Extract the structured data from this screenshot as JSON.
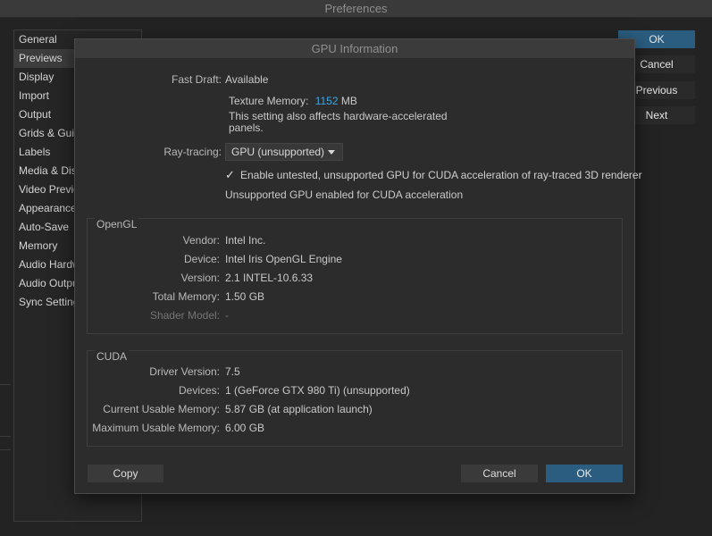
{
  "prefs": {
    "title": "Preferences",
    "sidebar": [
      {
        "label": "General",
        "selected": false
      },
      {
        "label": "Previews",
        "selected": true
      },
      {
        "label": "Display",
        "selected": false
      },
      {
        "label": "Import",
        "selected": false
      },
      {
        "label": "Output",
        "selected": false
      },
      {
        "label": "Grids & Guid",
        "selected": false
      },
      {
        "label": "Labels",
        "selected": false
      },
      {
        "label": "Media & Disk",
        "selected": false
      },
      {
        "label": "Video Previe",
        "selected": false
      },
      {
        "label": "Appearance",
        "selected": false
      },
      {
        "label": "Auto-Save",
        "selected": false
      },
      {
        "label": "Memory",
        "selected": false
      },
      {
        "label": "Audio Hardw",
        "selected": false
      },
      {
        "label": "Audio Outpu",
        "selected": false
      },
      {
        "label": "Sync Setting",
        "selected": false
      }
    ],
    "buttons": {
      "ok": "OK",
      "cancel": "Cancel",
      "previous": "Previous",
      "next": "Next"
    }
  },
  "dialog": {
    "title": "GPU Information",
    "fast_draft": {
      "label": "Fast Draft:",
      "value": "Available"
    },
    "texture_memory": {
      "label": "Texture Memory:",
      "value": "1152",
      "unit": "MB"
    },
    "note": {
      "line1": "This setting also affects hardware-accelerated",
      "line2": "panels."
    },
    "ray_tracing": {
      "label": "Ray-tracing:",
      "value": "GPU (unsupported)"
    },
    "checkbox": {
      "label": "Enable untested, unsupported GPU for CUDA acceleration of ray-traced 3D renderer",
      "checked": true
    },
    "status": "Unsupported GPU enabled for CUDA acceleration",
    "opengl": {
      "title": "OpenGL",
      "rows": [
        {
          "label": "Vendor:",
          "value": "Intel Inc."
        },
        {
          "label": "Device:",
          "value": "Intel Iris OpenGL Engine"
        },
        {
          "label": "Version:",
          "value": "2.1 INTEL-10.6.33"
        },
        {
          "label": "Total Memory:",
          "value": "1.50 GB"
        },
        {
          "label": "Shader Model:",
          "value": "-"
        }
      ]
    },
    "cuda": {
      "title": "CUDA",
      "rows": [
        {
          "label": "Driver Version:",
          "value": "7.5"
        },
        {
          "label": "Devices:",
          "value": "1 (GeForce GTX 980 Ti) (unsupported)"
        },
        {
          "label": "Current Usable Memory:",
          "value": "5.87 GB (at application launch)"
        },
        {
          "label": "Maximum Usable Memory:",
          "value": "6.00 GB"
        }
      ]
    },
    "buttons": {
      "copy": "Copy",
      "cancel": "Cancel",
      "ok": "OK"
    }
  },
  "colors": {
    "accent": "#3ea6e4",
    "primary_button": "#2b5d80"
  }
}
